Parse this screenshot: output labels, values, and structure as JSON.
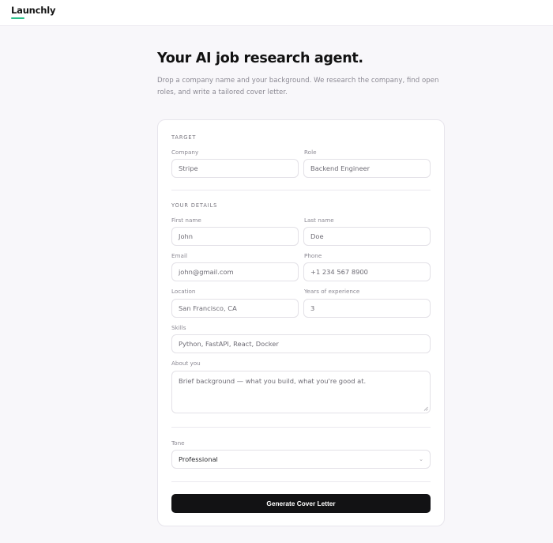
{
  "app": {
    "name": "Launchly"
  },
  "hero": {
    "title": "Your AI job research agent.",
    "subtitle": "Drop a company name and your background. We research the company, find open roles, and write a tailored cover letter."
  },
  "target": {
    "section_label": "TARGET",
    "company": {
      "label": "Company",
      "placeholder": "Stripe"
    },
    "role": {
      "label": "Role",
      "placeholder": "Backend Engineer"
    }
  },
  "details": {
    "section_label": "YOUR DETAILS",
    "first_name": {
      "label": "First name",
      "placeholder": "John"
    },
    "last_name": {
      "label": "Last name",
      "placeholder": "Doe"
    },
    "email": {
      "label": "Email",
      "placeholder": "john@gmail.com"
    },
    "phone": {
      "label": "Phone",
      "placeholder": "+1 234 567 8900"
    },
    "location": {
      "label": "Location",
      "placeholder": "San Francisco, CA"
    },
    "years": {
      "label": "Years of experience",
      "placeholder": "3"
    },
    "skills": {
      "label": "Skills",
      "placeholder": "Python, FastAPI, React, Docker"
    },
    "about": {
      "label": "About you",
      "placeholder": "Brief background — what you build, what you're good at."
    }
  },
  "tone": {
    "label": "Tone",
    "selected": "Professional",
    "chevron_icon": "chevron-down-icon"
  },
  "actions": {
    "generate_label": "Generate Cover Letter"
  },
  "colors": {
    "accent": "#2bbf8a",
    "button_bg": "#121214",
    "page_bg": "#f8f7fa"
  }
}
